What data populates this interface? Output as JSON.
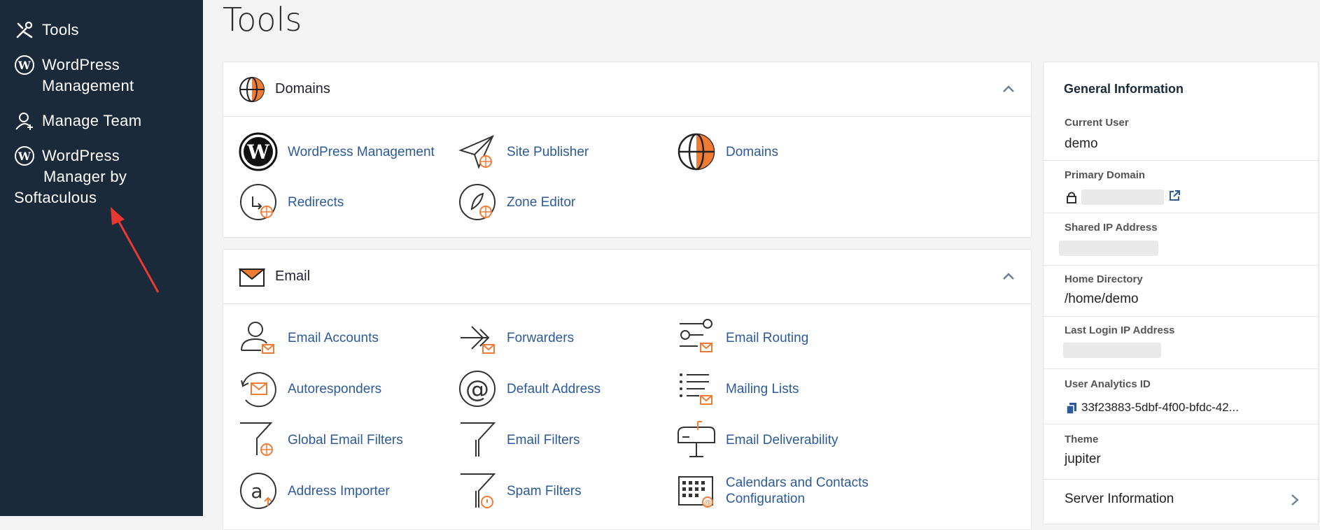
{
  "sidebar": {
    "items": [
      {
        "label": "Tools",
        "icon": "tools-icon"
      },
      {
        "label": "WordPress Management",
        "icon": "wordpress-icon"
      },
      {
        "label": "Manage Team",
        "icon": "team-icon"
      },
      {
        "label": "WordPress Manager by Softaculous",
        "icon": "wordpress-icon"
      }
    ],
    "label_lines": {
      "wp_mgmt_1": "WordPress",
      "wp_mgmt_2": "Management",
      "wp_soft_1": "WordPress",
      "wp_soft_2": "Manager by",
      "wp_soft_3": "Softaculous"
    }
  },
  "page": {
    "title": "Tools"
  },
  "domains": {
    "title": "Domains",
    "tools": [
      {
        "label": "WordPress Management",
        "icon": "wordpress-icon"
      },
      {
        "label": "Site Publisher",
        "icon": "paper-plane-icon"
      },
      {
        "label": "Domains",
        "icon": "globe-icon"
      },
      {
        "label": "Redirects",
        "icon": "redirect-icon"
      },
      {
        "label": "Zone Editor",
        "icon": "zone-editor-icon"
      }
    ]
  },
  "email": {
    "title": "Email",
    "tools": [
      {
        "label": "Email Accounts",
        "icon": "user-mail-icon"
      },
      {
        "label": "Forwarders",
        "icon": "forward-icon"
      },
      {
        "label": "Email Routing",
        "icon": "routing-icon"
      },
      {
        "label": "Autoresponders",
        "icon": "autoresponder-icon"
      },
      {
        "label": "Default Address",
        "icon": "at-icon"
      },
      {
        "label": "Mailing Lists",
        "icon": "list-icon"
      },
      {
        "label": "Global Email Filters",
        "icon": "filter-globe-icon"
      },
      {
        "label": "Email Filters",
        "icon": "filter-icon"
      },
      {
        "label": "Email Deliverability",
        "icon": "mailbox-icon"
      },
      {
        "label": "Address Importer",
        "icon": "import-icon"
      },
      {
        "label": "Spam Filters",
        "icon": "spam-filter-icon"
      },
      {
        "label": "Calendars and Contacts Configuration",
        "icon": "calendar-icon"
      }
    ],
    "calendar_lines": {
      "line1": "Calendars and Contacts",
      "line2": "Configuration"
    }
  },
  "general_info": {
    "title": "General Information",
    "current_user_label": "Current User",
    "current_user": "demo",
    "primary_domain_label": "Primary Domain",
    "shared_ip_label": "Shared IP Address",
    "home_dir_label": "Home Directory",
    "home_dir": "/home/demo",
    "last_login_label": "Last Login IP Address",
    "analytics_label": "User Analytics ID",
    "analytics_id": "33f23883-5dbf-4f00-bfdc-42...",
    "theme_label": "Theme",
    "theme": "jupiter",
    "server_info": "Server Information"
  },
  "colors": {
    "sidebar_bg": "#1b2a3a",
    "link": "#2c5a9a",
    "accent": "#f07b35",
    "annotation": "#e8382f"
  }
}
